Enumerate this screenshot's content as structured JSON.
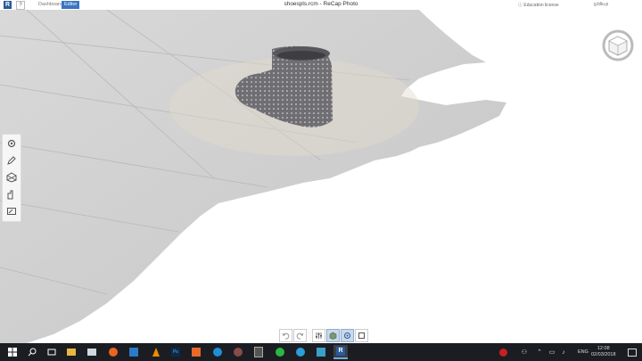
{
  "app": {
    "window_title": "shoespls.rcm - ReCap Photo",
    "logo_letter": "R",
    "help_label": "?",
    "tabs": [
      {
        "label": "Dashboard",
        "active": false
      },
      {
        "label": "Editor",
        "active": true
      }
    ],
    "license_text": "Education license",
    "user_text": "g.bliu.p",
    "accent_color": "#3a76c2"
  },
  "left_toolbar": {
    "tools": [
      "settings-icon",
      "pencil-icon",
      "mesh-icon",
      "measure-icon",
      "export-icon"
    ]
  },
  "bottom_toolbar": {
    "tools": [
      "undo-icon",
      "redo-icon",
      "sliders-icon",
      "textured-cube-icon",
      "orbit-icon",
      "crop-icon"
    ],
    "active": [
      "textured-cube-icon",
      "orbit-icon"
    ]
  },
  "taskbar": {
    "language": "ENG",
    "time": "12:08",
    "date": "02/03/2018"
  }
}
